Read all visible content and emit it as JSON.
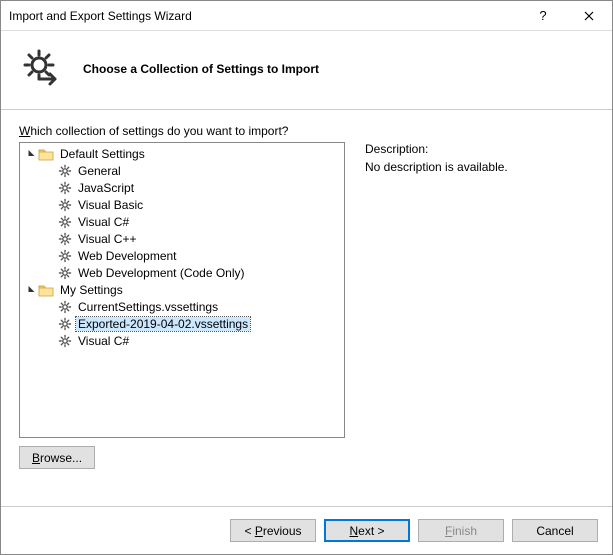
{
  "window": {
    "title": "Import and Export Settings Wizard",
    "help": "?",
    "close": "×"
  },
  "header": {
    "title": "Choose a Collection of Settings to Import"
  },
  "prompt": {
    "prefix": "W",
    "rest": "hich collection of settings do you want to import?"
  },
  "tree": {
    "default_label": "Default Settings",
    "default_items": [
      "General",
      "JavaScript",
      "Visual Basic",
      "Visual C#",
      "Visual C++",
      "Web Development",
      "Web Development (Code Only)"
    ],
    "my_label": "My Settings",
    "my_items": [
      "CurrentSettings.vssettings",
      "Exported-2019-04-02.vssettings",
      "Visual C#"
    ],
    "selected": "Exported-2019-04-02.vssettings"
  },
  "description": {
    "label": "Description:",
    "text": "No description is available."
  },
  "buttons": {
    "browse": "Browse...",
    "previous": "< Previous",
    "next": "Next >",
    "finish": "Finish",
    "cancel": "Cancel"
  }
}
